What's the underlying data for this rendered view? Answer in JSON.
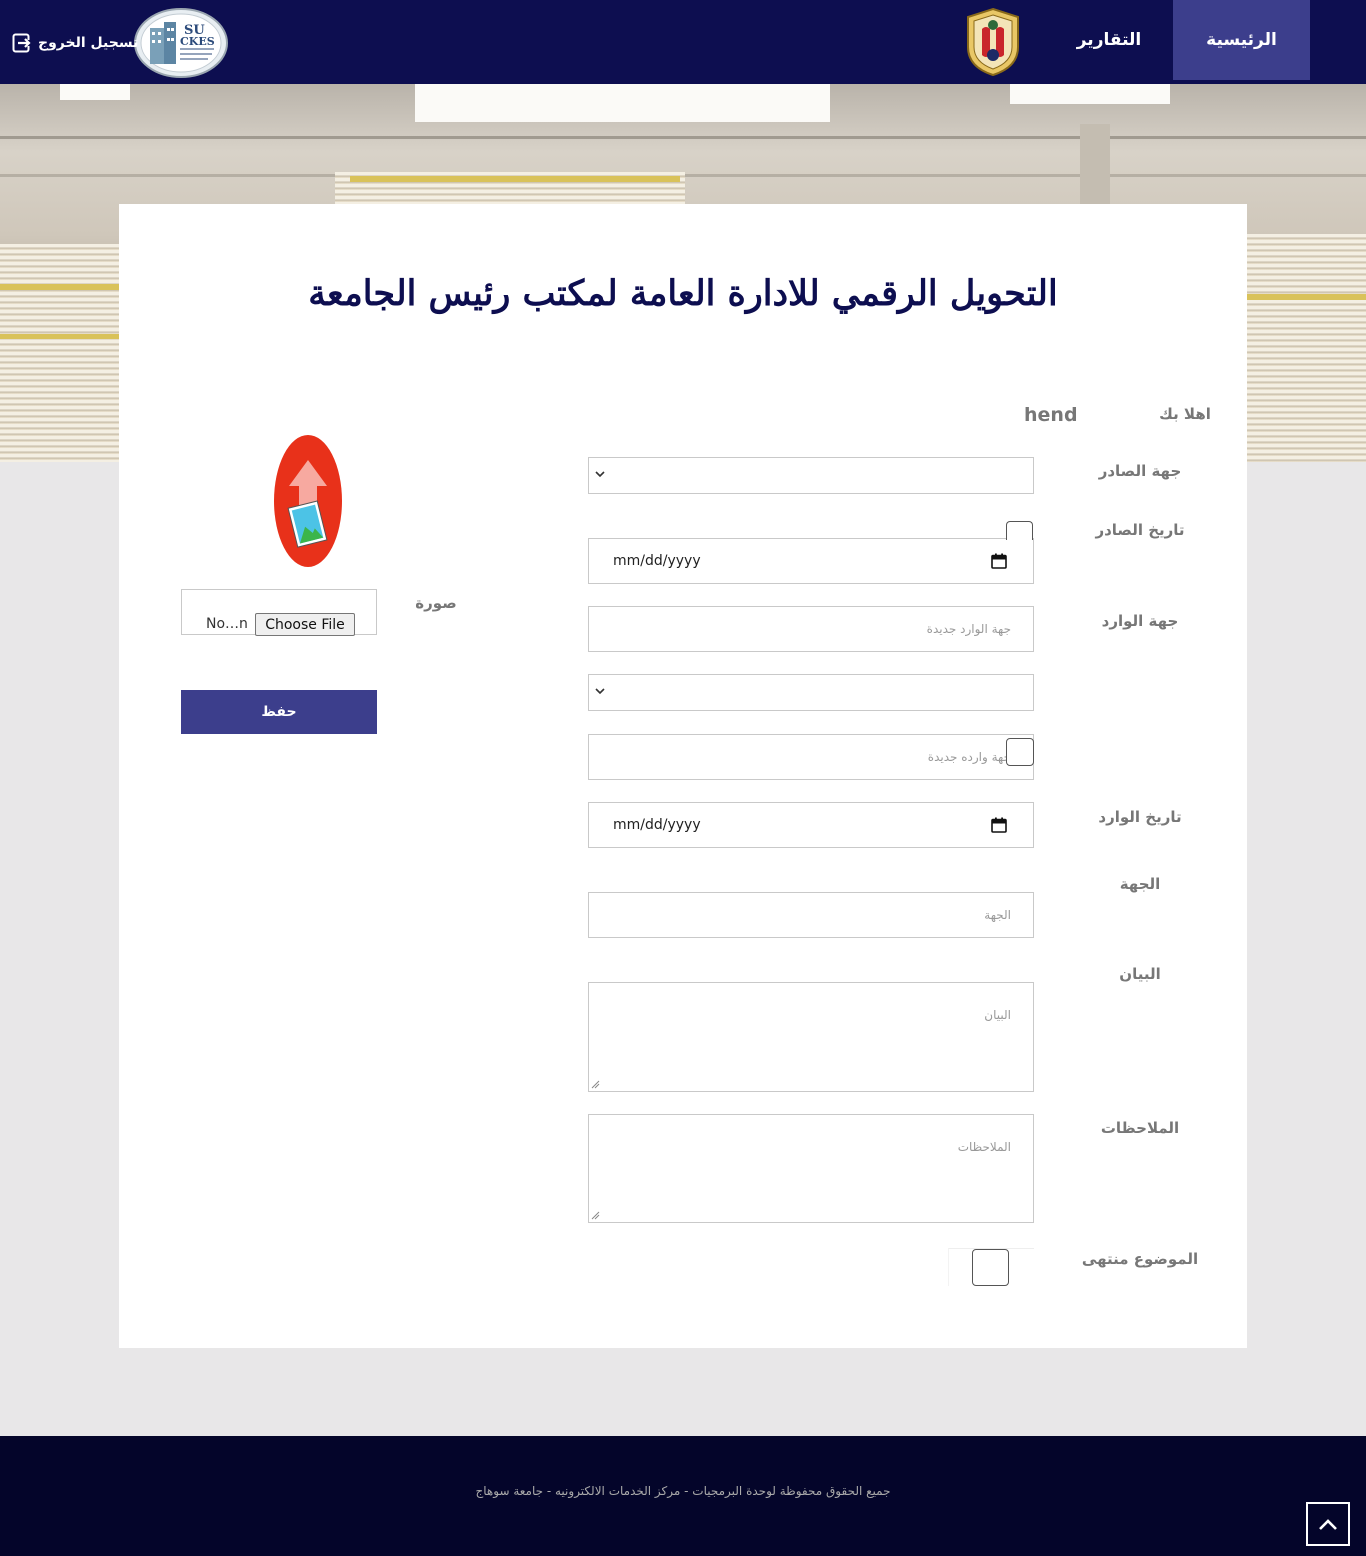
{
  "navbar": {
    "home_label": "الرئيسية",
    "reports_label": "التقارير",
    "logout_label": "تسجيل الخروج",
    "sukes_logo_text": "SU CKES"
  },
  "page": {
    "title": "التحويل الرقمي للادارة العامة لمكتب رئيس الجامعة",
    "welcome_label": "اهلا بك",
    "username": "hend"
  },
  "form": {
    "issuer_label": "جهة الصادر",
    "issue_date_label": "تاريخ الصادر",
    "issue_date_value": "mm/dd/yyyy",
    "incoming_label": "جهة الوارد",
    "incoming_new_placeholder": "جهة الوارد جديدة",
    "incoming_new2_placeholder": "جهة وارده جديدة",
    "incoming_date_label": "تاريخ الوارد",
    "incoming_date_value": "mm/dd/yyyy",
    "party_label": "الجهة",
    "party_placeholder": "الجهة",
    "statement_label": "البيان",
    "statement_placeholder": "البيان",
    "notes_label": "الملاحظات",
    "notes_placeholder": "الملاحظات",
    "closed_label": "الموضوع منتهى",
    "image_label": "صورة",
    "file_name": "No…n",
    "file_button": "Choose File",
    "save_label": "حفظ"
  },
  "footer": {
    "copyright": "جميع الحقوق محفوظة لوحدة البرمجيات - مركز الخدمات الالكترونيه - جامعة سوهاج"
  },
  "icons": {
    "logout": "logout-icon",
    "upload": "upload-image-icon",
    "calendar": "calendar-icon",
    "chevron": "chevron-down-icon",
    "to_top": "chevron-up-icon"
  },
  "colors": {
    "navbar": "#0d0e50",
    "accent": "#3c3e8c",
    "footer": "#04052a",
    "page_bg": "#e8e7e8"
  }
}
